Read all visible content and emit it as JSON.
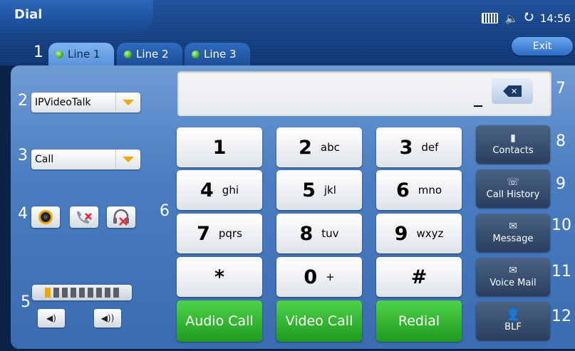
{
  "header": {
    "title": "Dial",
    "time": "14:56",
    "exit_label": "Exit"
  },
  "line_tabs": [
    {
      "label": "Line 1",
      "active": true
    },
    {
      "label": "Line 2",
      "active": false
    },
    {
      "label": "Line 3",
      "active": false
    }
  ],
  "annotations": [
    "1",
    "2",
    "3",
    "4",
    "5",
    "6",
    "7",
    "8",
    "9",
    "10",
    "11",
    "12"
  ],
  "controls": {
    "account_select": "IPVideoTalk",
    "mode_select": "Call"
  },
  "volume_level": {
    "on": 1,
    "total": 9
  },
  "keypad": [
    {
      "digit": "1",
      "letters": ""
    },
    {
      "digit": "2",
      "letters": "abc"
    },
    {
      "digit": "3",
      "letters": "def"
    },
    {
      "digit": "4",
      "letters": "ghi"
    },
    {
      "digit": "5",
      "letters": "jkl"
    },
    {
      "digit": "6",
      "letters": "mno"
    },
    {
      "digit": "7",
      "letters": "pqrs"
    },
    {
      "digit": "8",
      "letters": "tuv"
    },
    {
      "digit": "9",
      "letters": "wxyz"
    },
    {
      "digit": "*",
      "letters": ""
    },
    {
      "digit": "0",
      "letters": "+"
    },
    {
      "digit": "#",
      "letters": ""
    }
  ],
  "actions": {
    "audio_call": "Audio Call",
    "video_call": "Video Call",
    "redial": "Redial"
  },
  "side_buttons": [
    "Contacts",
    "Call History",
    "Message",
    "Voice Mail",
    "BLF"
  ],
  "colors": {
    "accent": "#2ea21b",
    "call_green": "#1f9a1d",
    "select_arrow": "#f0a800"
  }
}
